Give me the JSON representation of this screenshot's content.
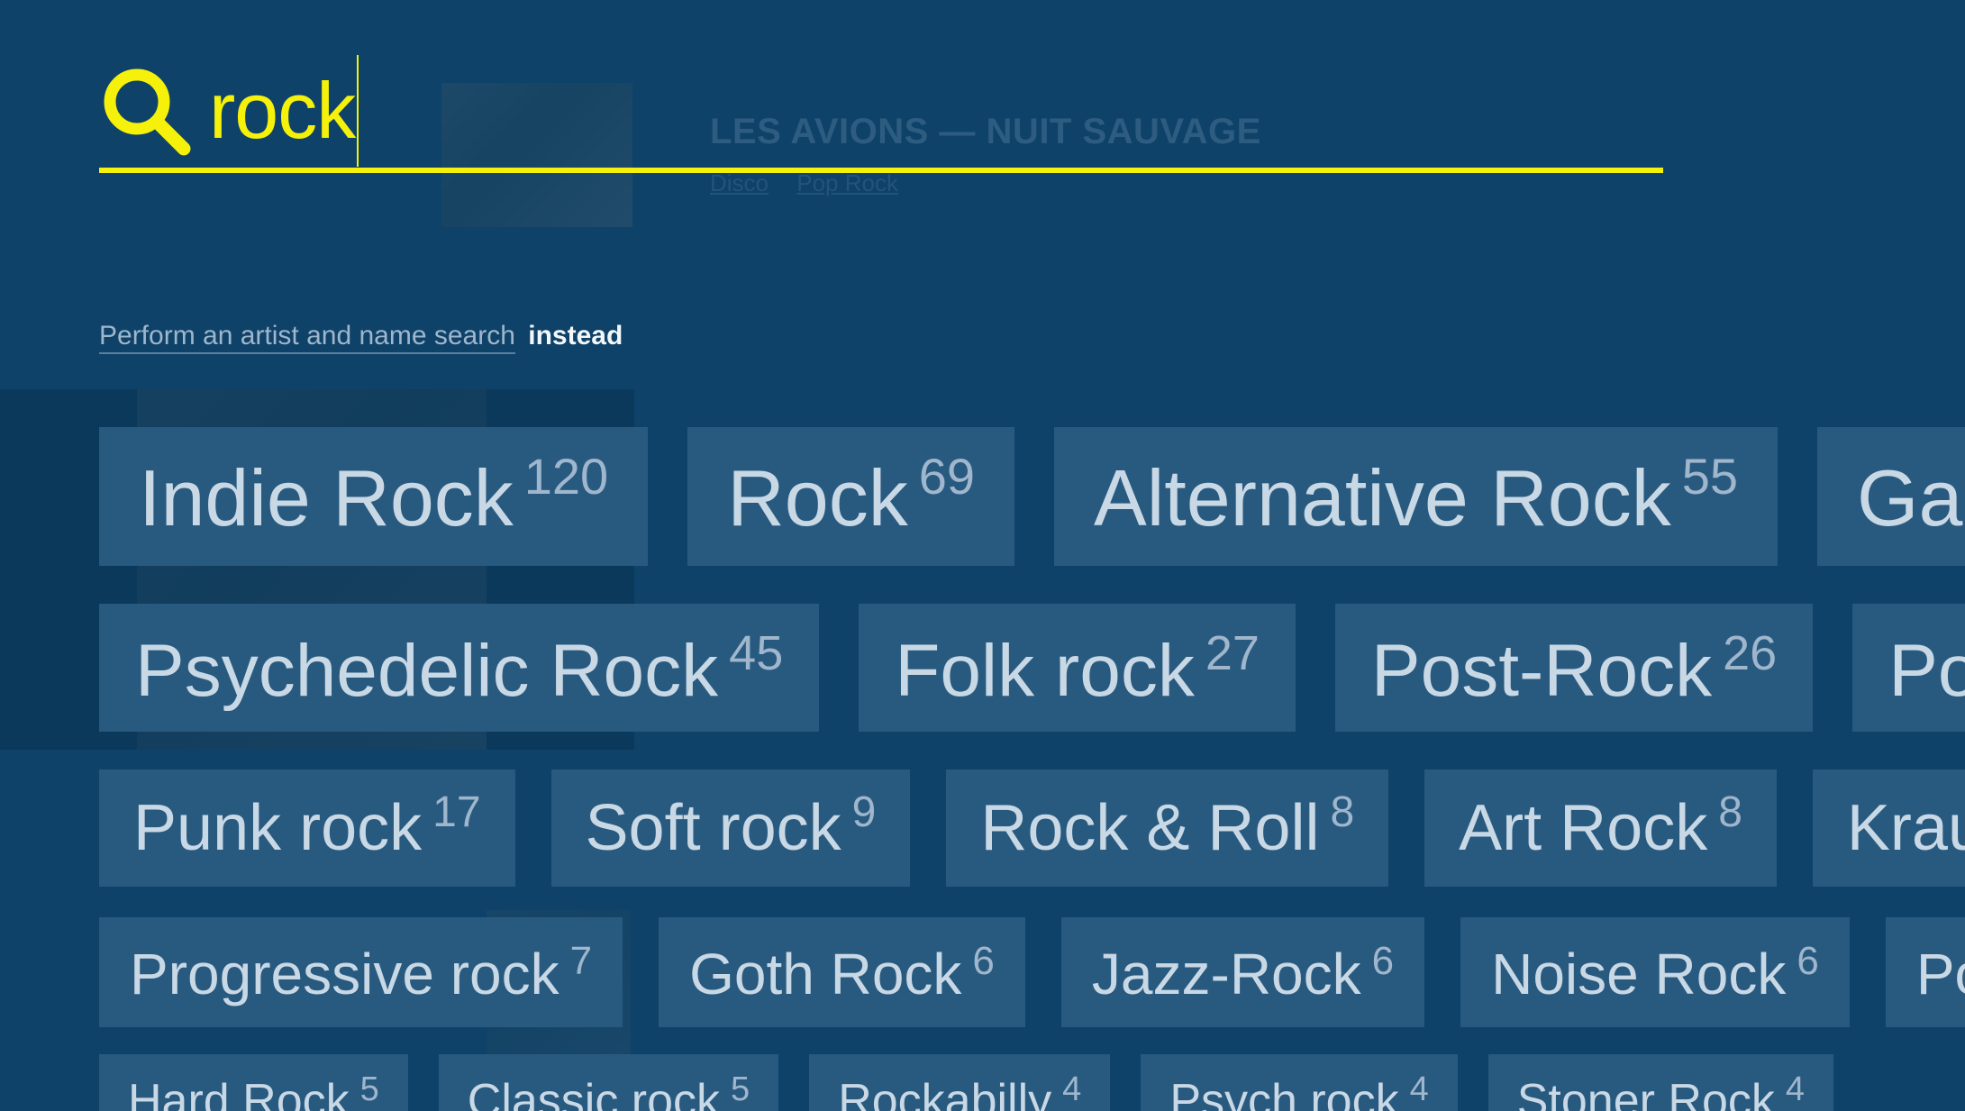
{
  "search": {
    "query": "rock"
  },
  "background": {
    "album_title": "LES AVIONS — NUIT SAUVAGE",
    "album_tags": [
      "Disco",
      "Pop Rock"
    ]
  },
  "alt_search": {
    "link_text": "Perform an artist and name search",
    "suffix_text": "instead"
  },
  "genres": {
    "row1": [
      {
        "name": "Indie Rock",
        "count": "120"
      },
      {
        "name": "Rock",
        "count": "69"
      },
      {
        "name": "Alternative Rock",
        "count": "55"
      },
      {
        "name": "Garage",
        "count": ""
      }
    ],
    "row2": [
      {
        "name": "Psychedelic Rock",
        "count": "45"
      },
      {
        "name": "Folk rock",
        "count": "27"
      },
      {
        "name": "Post-Rock",
        "count": "26"
      },
      {
        "name": "Pop Ro",
        "count": ""
      }
    ],
    "row3": [
      {
        "name": "Punk rock",
        "count": "17"
      },
      {
        "name": "Soft rock",
        "count": "9"
      },
      {
        "name": "Rock & Roll",
        "count": "8"
      },
      {
        "name": "Art Rock",
        "count": "8"
      },
      {
        "name": "Krautro",
        "count": ""
      }
    ],
    "row4": [
      {
        "name": "Progressive rock",
        "count": "7"
      },
      {
        "name": "Goth Rock",
        "count": "6"
      },
      {
        "name": "Jazz-Rock",
        "count": "6"
      },
      {
        "name": "Noise Rock",
        "count": "6"
      },
      {
        "name": "Pop-",
        "count": ""
      }
    ],
    "row5": [
      {
        "name": "Hard Rock",
        "count": "5"
      },
      {
        "name": "Classic rock",
        "count": "5"
      },
      {
        "name": "Rockabilly",
        "count": "4"
      },
      {
        "name": "Psych rock",
        "count": "4"
      },
      {
        "name": "Stoner Rock",
        "count": "4"
      }
    ]
  },
  "colors": {
    "background": "#0e4268",
    "accent": "#f5f10a",
    "chip_bg": "#285a80",
    "chip_text": "#c9d8e5"
  }
}
